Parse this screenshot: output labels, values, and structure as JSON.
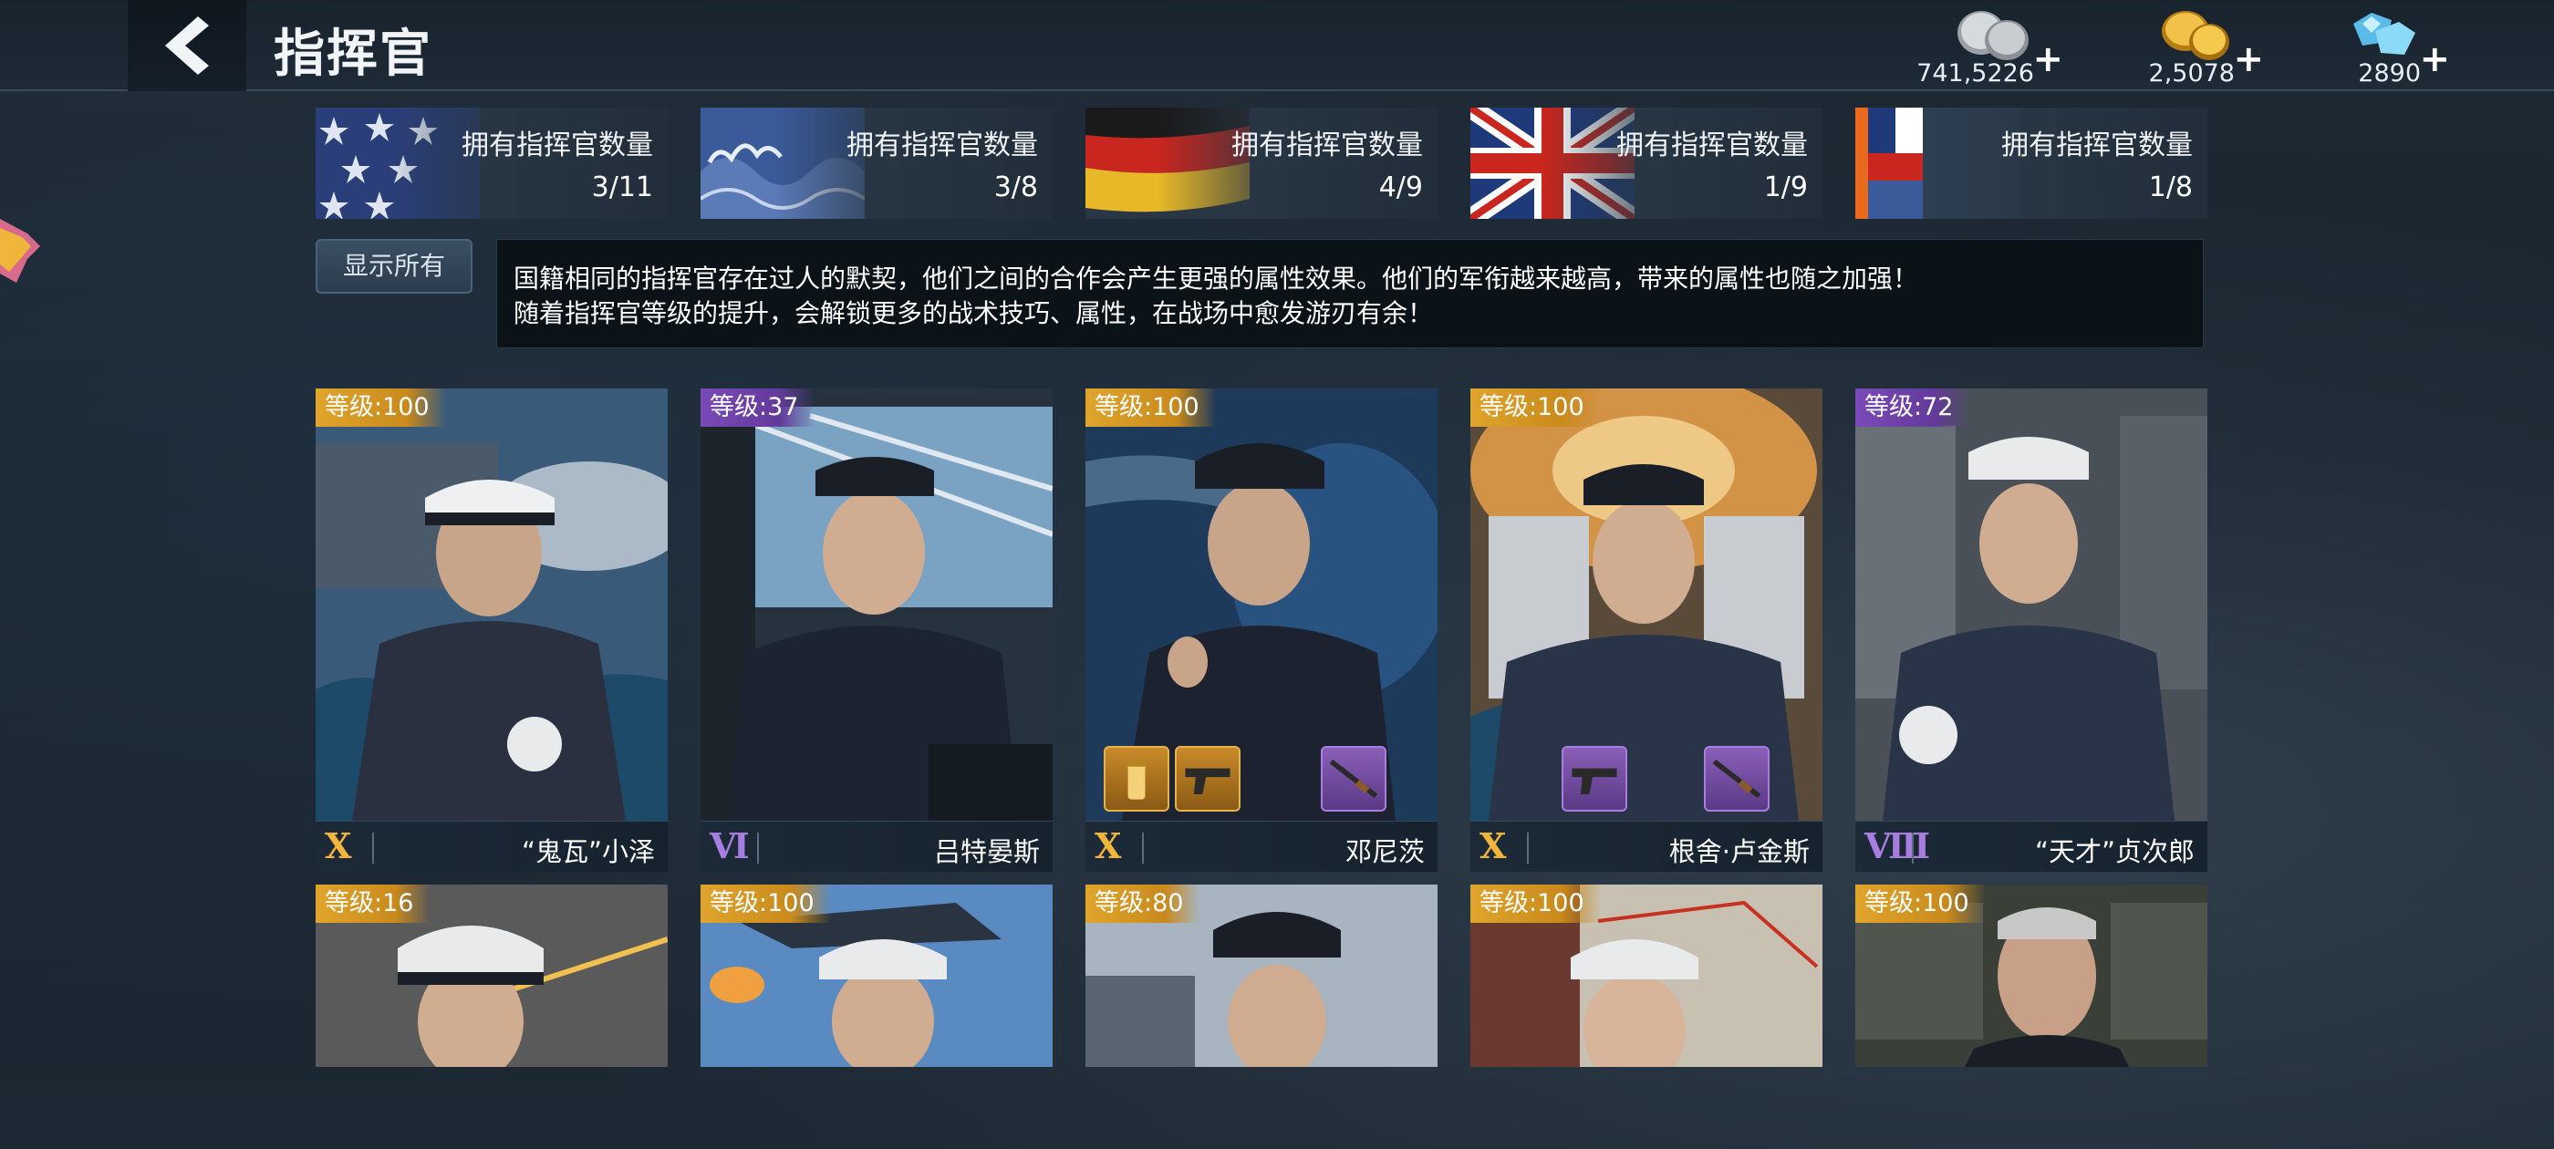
{
  "header": {
    "title": "指挥官",
    "currencies": [
      {
        "name": "silver",
        "value": "741,5226",
        "plus": "+",
        "color": "#c8ccd0"
      },
      {
        "name": "gold",
        "value": "2,5078",
        "plus": "+",
        "color": "#f0b53a"
      },
      {
        "name": "diamond",
        "value": "2890",
        "plus": "+",
        "color": "#7ad0f5"
      }
    ]
  },
  "nations": [
    {
      "flag": "usa-flag",
      "label": "拥有指挥官数量",
      "count": "3/11"
    },
    {
      "flag": "japan-flag",
      "label": "拥有指挥官数量",
      "count": "3/8"
    },
    {
      "flag": "germany-flag",
      "label": "拥有指挥官数量",
      "count": "4/9"
    },
    {
      "flag": "uk-flag",
      "label": "拥有指挥官数量",
      "count": "1/9"
    },
    {
      "flag": "other-flag",
      "label": "拥有指挥官数量",
      "count": "1/8"
    }
  ],
  "filter": {
    "show_all_label": "显示所有"
  },
  "description": {
    "line1": "国籍相同的指挥官存在过人的默契，他们之间的合作会产生更强的属性效果。他们的军衔越来越高，带来的属性也随之加强！",
    "line2": "随着指挥官等级的提升，会解锁更多的战术技巧、属性，在战场中愈发游刃有余！"
  },
  "commanders_row1": [
    {
      "level": "等级:100",
      "rarity": "gold",
      "rank": "X",
      "name": "“鬼瓦”小泽",
      "equipment": []
    },
    {
      "level": "等级:37",
      "rarity": "purple",
      "rank": "Ⅵ",
      "name": "吕特晏斯",
      "equipment": []
    },
    {
      "level": "等级:100",
      "rarity": "gold",
      "rank": "X",
      "name": "邓尼茨",
      "equipment": [
        "medal-icon",
        "pistol-icon",
        "rifle-icon"
      ]
    },
    {
      "level": "等级:100",
      "rarity": "gold",
      "rank": "X",
      "name": "根舍·卢金斯",
      "equipment": [
        "pistol-icon",
        "rifle-icon"
      ]
    },
    {
      "level": "等级:72",
      "rarity": "purple",
      "rank": "Ⅷ",
      "name": "“天才”贞次郎",
      "equipment": []
    }
  ],
  "commanders_row2": [
    {
      "level": "等级:16",
      "rarity": "gold"
    },
    {
      "level": "等级:100",
      "rarity": "gold"
    },
    {
      "level": "等级:80",
      "rarity": "gold"
    },
    {
      "level": "等级:100",
      "rarity": "gold"
    },
    {
      "level": "等级:100",
      "rarity": "gold"
    }
  ]
}
